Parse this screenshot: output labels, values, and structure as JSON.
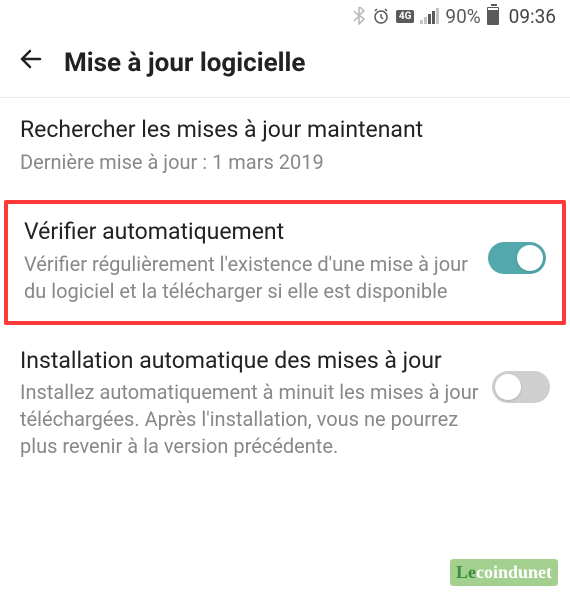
{
  "status": {
    "data_label": "4G",
    "battery_pct": "90%",
    "time": "09:36"
  },
  "header": {
    "title": "Mise à jour logicielle"
  },
  "items": [
    {
      "title": "Rechercher les mises à jour maintenant",
      "sub": "Dernière mise à jour : 1 mars 2019"
    },
    {
      "title": "Vérifier automatiquement",
      "sub": "Vérifier régulièrement l'existence d'une mise à jour du logiciel et la télécharger si elle est disponible"
    },
    {
      "title": "Installation automatique des mises à jour",
      "sub": "Installez automatiquement à minuit les mises à jour téléchargées. Après l'installation, vous ne pourrez plus revenir à la version précédente."
    }
  ],
  "watermark": {
    "part1": "Le",
    "part2": "coindunet"
  }
}
